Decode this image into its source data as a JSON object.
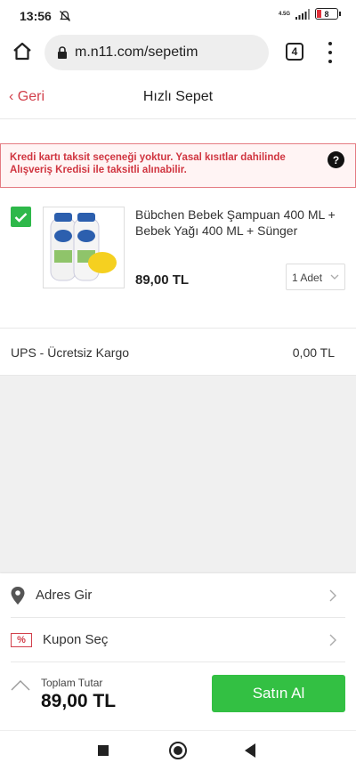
{
  "status_bar": {
    "time": "13:56",
    "network": "4.5G",
    "battery": "8"
  },
  "browser": {
    "url": "m.n11.com/sepetim",
    "tab_count": "4"
  },
  "header": {
    "back_label": "Geri",
    "title": "Hızlı Sepet"
  },
  "warning": {
    "text": "Kredi kartı taksit seçeneği yoktur. Yasal kısıtlar dahilinde Alışveriş Kredisi ile taksitli alınabilir.",
    "help": "?"
  },
  "product": {
    "name": "Bübchen Bebek Şampuan 400 ML + Bebek Yağı 400 ML + Sünger",
    "price": "89,00 TL",
    "quantity": "1 Adet",
    "checked": true
  },
  "shipping": {
    "label": "UPS - Ücretsiz Kargo",
    "value": "0,00 TL"
  },
  "bottom": {
    "address_label": "Adres Gir",
    "coupon_label": "Kupon Seç",
    "coupon_icon": "%",
    "total_label": "Toplam Tutar",
    "total_value": "89,00 TL",
    "buy_label": "Satın Al"
  },
  "colors": {
    "accent_red": "#d23f4b",
    "buy_green": "#33c043",
    "check_green": "#2eb84a"
  }
}
